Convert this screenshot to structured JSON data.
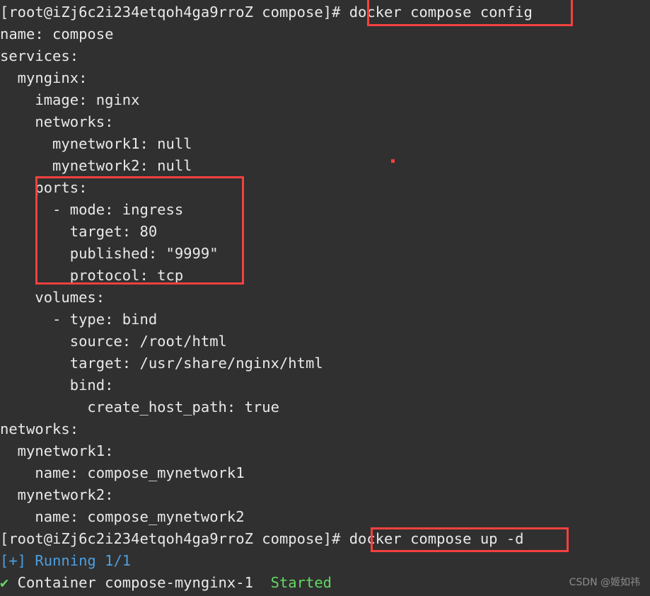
{
  "terminal": {
    "background_color": "#303030",
    "foreground_color": "#e9e9e9",
    "accent_blue": "#4d9fe0",
    "accent_green": "#63d863",
    "annotation_color": "#f4413f",
    "prompt": "[root@iZj6c2i234etqoh4ga9rroZ compose]# ",
    "lines": [
      {
        "id": "prompt-config",
        "kind": "prompt",
        "prompt": "[root@iZj6c2i234etqoh4ga9rroZ compose]# ",
        "command": "docker compose config"
      },
      {
        "id": "out-name",
        "kind": "output",
        "text": "name: compose"
      },
      {
        "id": "out-services",
        "kind": "output",
        "text": "services:"
      },
      {
        "id": "out-mynginx",
        "kind": "output",
        "text": "  mynginx:"
      },
      {
        "id": "out-image",
        "kind": "output",
        "text": "    image: nginx"
      },
      {
        "id": "out-networks-svc",
        "kind": "output",
        "text": "    networks:"
      },
      {
        "id": "out-mynetwork1-null",
        "kind": "output",
        "text": "      mynetwork1: null"
      },
      {
        "id": "out-mynetwork2-null",
        "kind": "output",
        "text": "      mynetwork2: null"
      },
      {
        "id": "out-ports",
        "kind": "output",
        "text": "    ports:"
      },
      {
        "id": "out-mode",
        "kind": "output",
        "text": "      - mode: ingress"
      },
      {
        "id": "out-target-80",
        "kind": "output",
        "text": "        target: 80"
      },
      {
        "id": "out-published",
        "kind": "output",
        "text": "        published: \"9999\""
      },
      {
        "id": "out-protocol",
        "kind": "output",
        "text": "        protocol: tcp"
      },
      {
        "id": "out-volumes",
        "kind": "output",
        "text": "    volumes:"
      },
      {
        "id": "out-type-bind",
        "kind": "output",
        "text": "      - type: bind"
      },
      {
        "id": "out-source",
        "kind": "output",
        "text": "        source: /root/html"
      },
      {
        "id": "out-target-path",
        "kind": "output",
        "text": "        target: /usr/share/nginx/html"
      },
      {
        "id": "out-bind",
        "kind": "output",
        "text": "        bind:"
      },
      {
        "id": "out-create-host-path",
        "kind": "output",
        "text": "          create_host_path: true"
      },
      {
        "id": "out-networks-top",
        "kind": "output",
        "text": "networks:"
      },
      {
        "id": "out-net1",
        "kind": "output",
        "text": "  mynetwork1:"
      },
      {
        "id": "out-net1-name",
        "kind": "output",
        "text": "    name: compose_mynetwork1"
      },
      {
        "id": "out-net2",
        "kind": "output",
        "text": "  mynetwork2:"
      },
      {
        "id": "out-net2-name",
        "kind": "output",
        "text": "    name: compose_mynetwork2"
      },
      {
        "id": "prompt-up",
        "kind": "prompt",
        "prompt": "[root@iZj6c2i234etqoh4ga9rroZ compose]# ",
        "command": "docker compose up -d"
      },
      {
        "id": "out-running",
        "kind": "status-blue",
        "text": "[+] Running 1/1"
      },
      {
        "id": "out-container",
        "kind": "container",
        "check": "✔",
        "text": " Container compose-mynginx-1  ",
        "status": "Started"
      }
    ]
  },
  "annotations": {
    "box_config_label": "docker compose config",
    "box_ports_label": "ports block",
    "box_up_label": "docker compose up -d",
    "dot_label": "stray-mark"
  },
  "watermark": {
    "text": "CSDN @姬如祎"
  }
}
